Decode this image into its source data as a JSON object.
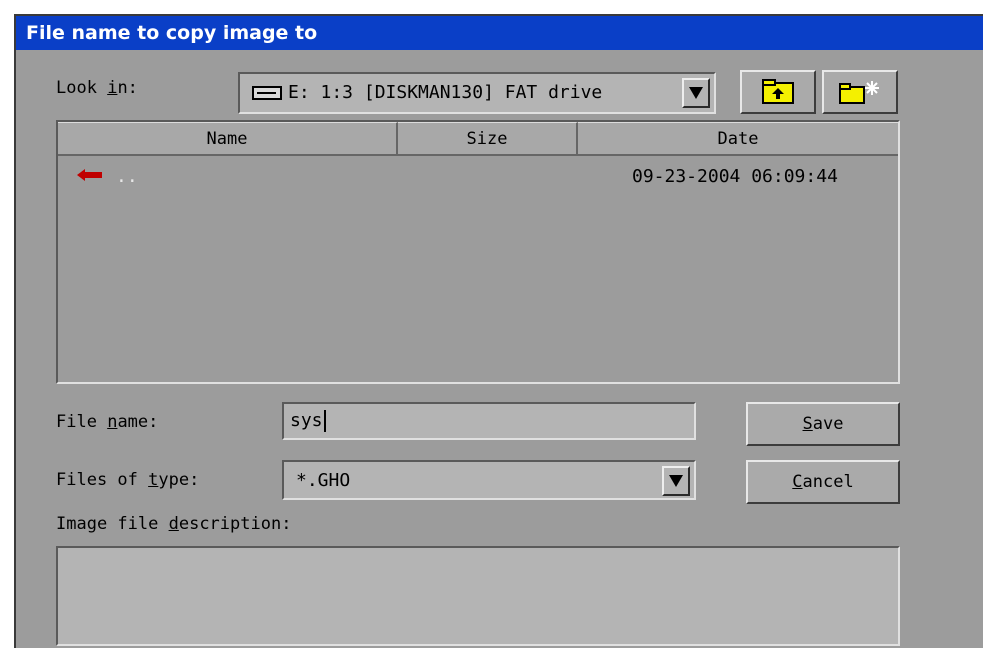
{
  "window": {
    "title": "File name to copy image to"
  },
  "look_in": {
    "label_before": "Look ",
    "label_mnemonic": "i",
    "label_after": "n:",
    "value": "E: 1:3 [DISKMAN130] FAT drive",
    "drive_icon": "drive-icon"
  },
  "toolbar": {
    "up_folder_icon": "up-folder-icon",
    "new_folder_icon": "new-folder-icon"
  },
  "file_list": {
    "columns": [
      "Name",
      "Size",
      "Date"
    ],
    "rows": [
      {
        "icon": "back-arrow-icon",
        "name": "..",
        "size": "",
        "date": "09-23-2004 06:09:44"
      }
    ]
  },
  "file_name": {
    "label_before": "File ",
    "label_mnemonic": "n",
    "label_after": "ame:",
    "value": "sys"
  },
  "file_type": {
    "label_before": "Files of ",
    "label_mnemonic": "t",
    "label_after": "ype:",
    "value": "*.GHO"
  },
  "description": {
    "label_before": "Image file ",
    "label_mnemonic": "d",
    "label_after": "escription:",
    "value": ""
  },
  "buttons": {
    "save_mnemonic": "S",
    "save_rest": "ave",
    "cancel_mnemonic": "C",
    "cancel_rest": "ancel"
  },
  "colors": {
    "titlebar": "#0a3fc7",
    "dialog_bg": "#9c9c9c",
    "folder_yellow": "#f4f000",
    "arrow_red": "#c00000"
  }
}
